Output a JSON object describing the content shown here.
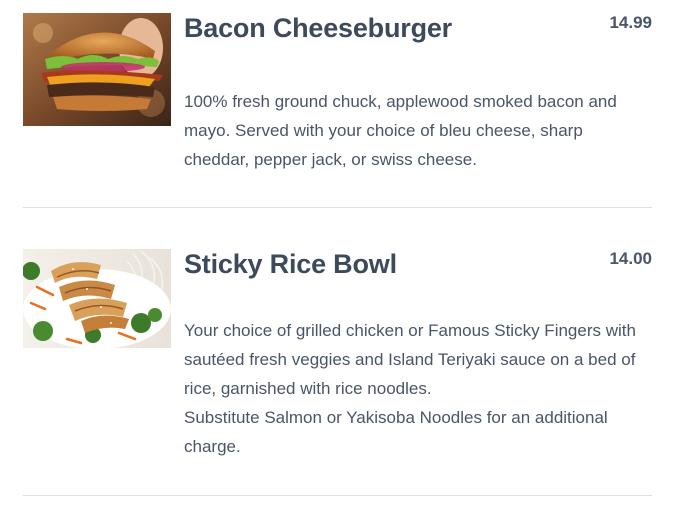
{
  "menu": {
    "items": [
      {
        "title": "Bacon Cheeseburger",
        "price": "14.99",
        "description": "100% fresh ground chuck, applewood smoked bacon and mayo. Served with your choice of bleu cheese, sharp cheddar, pepper jack, or swiss cheese.",
        "note": ""
      },
      {
        "title": "Sticky Rice Bowl",
        "price": "14.00",
        "description": "Your choice of grilled chicken or Famous Sticky Fingers with sautéed fresh veggies and Island Teriyaki sauce on a bed of rice, garnished with rice noodles.",
        "note": "Substitute Salmon or Yakisoba Noodles for an additional charge."
      }
    ]
  },
  "colors": {
    "text": "#3d4a5c",
    "divider": "#dcdfe3",
    "background": "#ffffff"
  }
}
